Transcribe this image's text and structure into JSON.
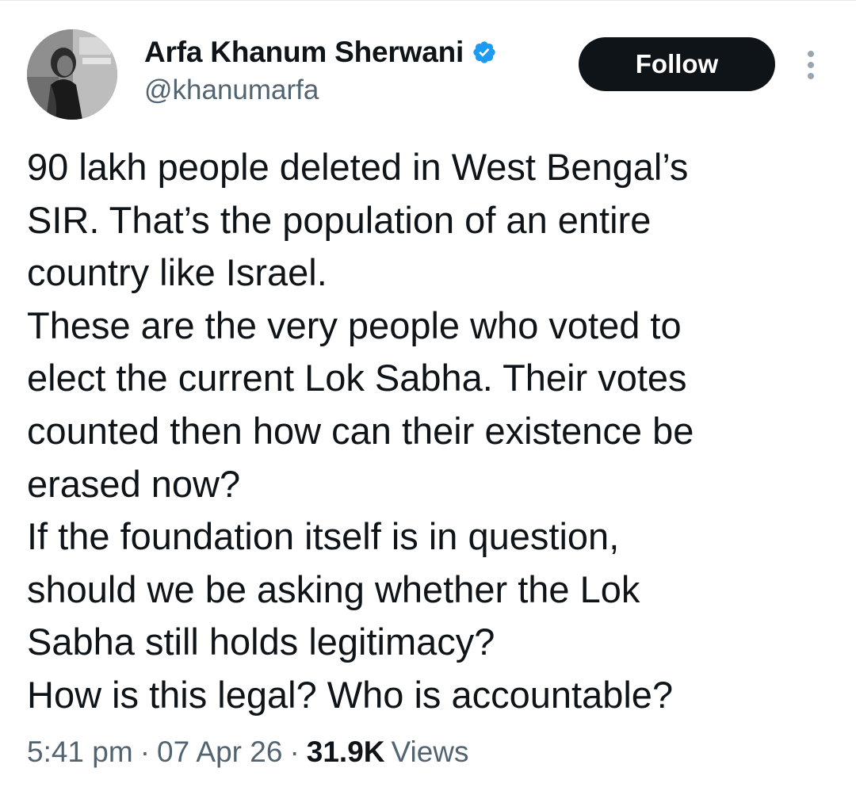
{
  "author": {
    "display_name": "Arfa Khanum Sherwani",
    "handle": "@khanumarfa",
    "verified_icon": "verified-badge-icon",
    "verified_color": "#1d9bf0"
  },
  "actions": {
    "follow_label": "Follow",
    "more_icon": "more-vertical-icon"
  },
  "tweet": {
    "lines": [
      "90 lakh people deleted in West Bengal’s",
      "SIR. That’s the population of an entire",
      "country like Israel.",
      "These are the very people who voted to",
      "elect the current Lok Sabha. Their votes",
      "counted then how can their existence be",
      "erased now?",
      "If the foundation itself is in question,",
      "should we be asking whether the Lok",
      "Sabha still holds legitimacy?",
      "How is this legal? Who is accountable?"
    ]
  },
  "meta": {
    "time": "5:41 pm",
    "separator": "·",
    "date": "07 Apr 26",
    "views_count": "31.9K",
    "views_label": "Views"
  },
  "colors": {
    "text_primary": "#0f1419",
    "text_secondary": "#536471",
    "follow_bg": "#0f1419",
    "follow_text": "#ffffff"
  }
}
